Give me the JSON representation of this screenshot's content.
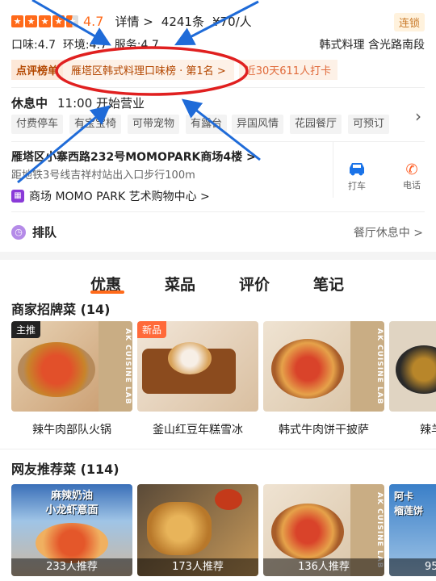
{
  "header": {
    "rating": "4.7",
    "details_link": "详情 >",
    "reviews": "4241条",
    "price": "¥70/人",
    "chain_badge": "连锁",
    "scores": "口味:4.7  环境:4.7  服务:4.7",
    "categories": "韩式料理 含光路南段"
  },
  "ranking": {
    "label": "点评榜单",
    "rank": "雁塔区韩式料理口味榜 · 第1名 >",
    "checkins": "近30天611人打卡"
  },
  "hours": {
    "status": "休息中",
    "time": "11:00 开始营业",
    "tags": [
      "付费停车",
      "有宝宝椅",
      "可带宠物",
      "有露台",
      "异国风情",
      "花园餐厅",
      "可预订"
    ]
  },
  "address": {
    "line": "雁塔区小寨西路232号MOMOPARK商场4楼 >",
    "distance": "距地铁3号线吉祥村站出入口步行100m",
    "mall": "商场 MOMO PARK 艺术购物中心 >",
    "taxi_label": "打车",
    "phone_label": "电话"
  },
  "queue": {
    "label": "排队",
    "status": "餐厅休息中 >"
  },
  "tabs": [
    "优惠",
    "菜品",
    "评价",
    "笔记"
  ],
  "signature": {
    "title": "商家招牌菜 (14)",
    "dishes": [
      {
        "name": "辣牛肉部队火锅",
        "badge": "主推"
      },
      {
        "name": "釜山红豆年糕雪冰",
        "badge": "新品"
      },
      {
        "name": "韩式牛肉饼干披萨",
        "badge": ""
      },
      {
        "name": "辣羊",
        "badge": ""
      }
    ],
    "lab_text": "AK CUISINE LAB"
  },
  "recommended": {
    "title": "网友推荐菜 (114)",
    "items": [
      {
        "count": "233人推荐",
        "overlay": "麻辣奶油 小龙虾意面"
      },
      {
        "count": "173人推荐",
        "overlay": ""
      },
      {
        "count": "136人推荐",
        "overlay": ""
      },
      {
        "count": "95",
        "overlay": "阿卡 榴莲饼"
      }
    ]
  },
  "colors": {
    "accent": "#ff6a1a",
    "annotation_blue": "#1f6bd8",
    "annotation_red": "#e02020",
    "chain_bg": "#fff2dd"
  }
}
